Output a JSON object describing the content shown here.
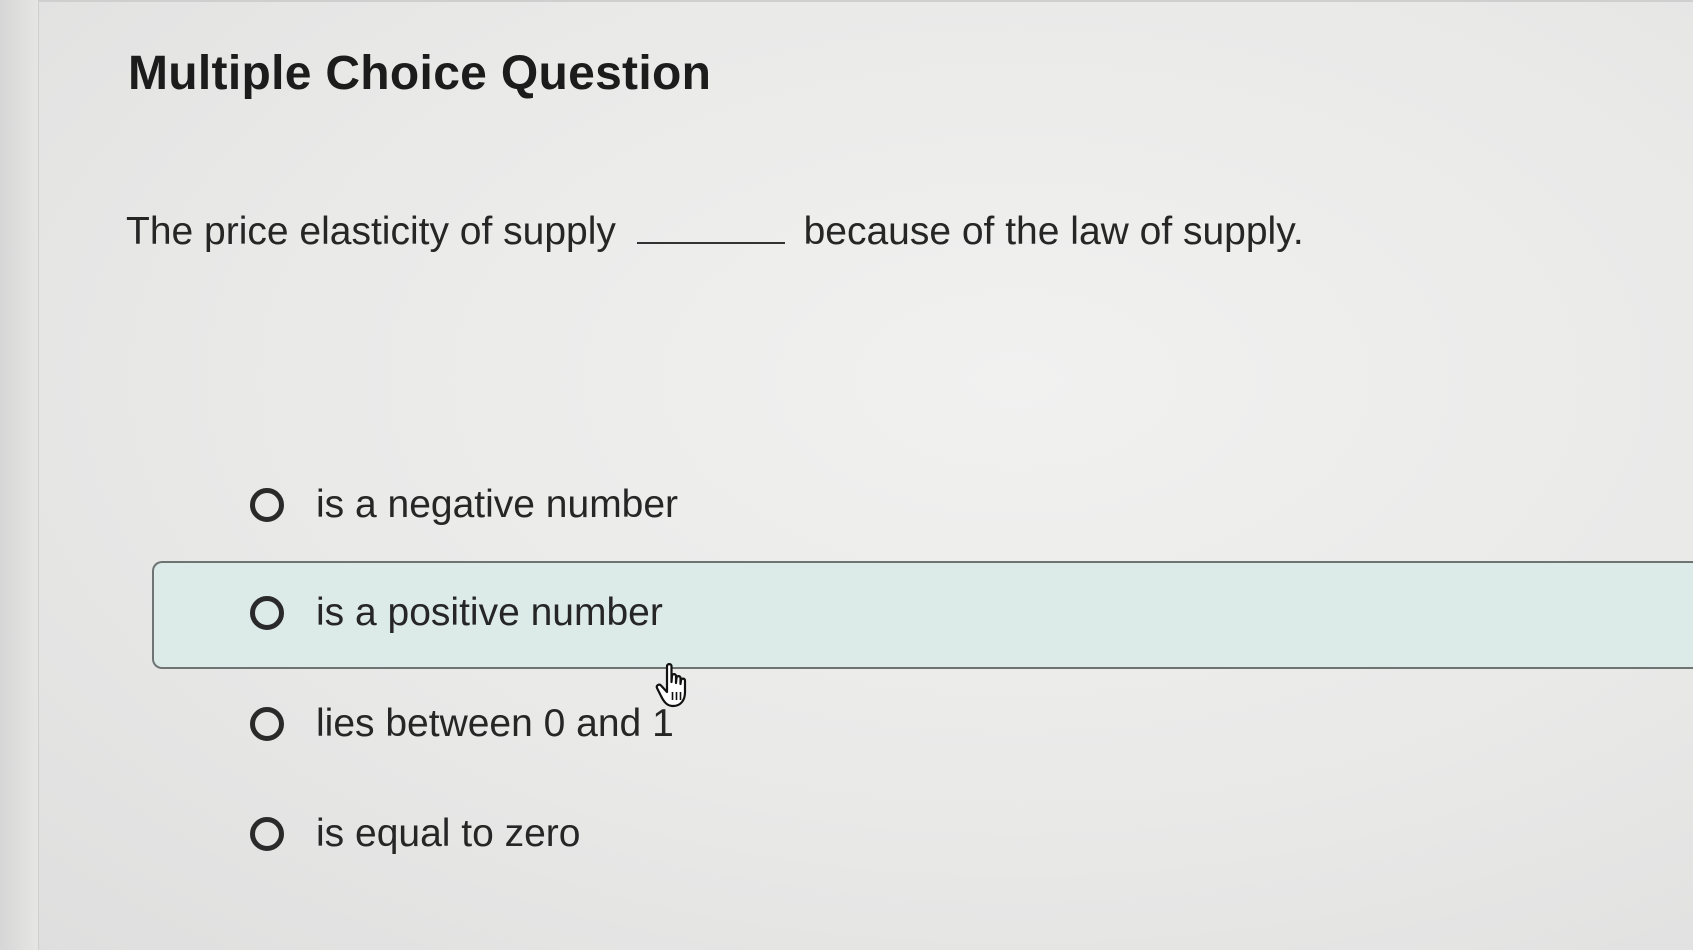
{
  "question": {
    "title": "Multiple Choice Question",
    "prompt_before": "The price elasticity of supply",
    "prompt_after": "because of the law of supply."
  },
  "options": [
    {
      "label": "is a negative number",
      "selected": false
    },
    {
      "label": "is a positive number",
      "selected": false,
      "hovered": true
    },
    {
      "label": "lies between 0 and 1",
      "selected": false
    },
    {
      "label": "is equal to zero",
      "selected": false
    }
  ],
  "icons": {
    "radio": "radio-button-icon",
    "cursor": "hand-pointer-icon"
  },
  "colors": {
    "hover_background": "#dcebe8",
    "text": "#262626"
  }
}
